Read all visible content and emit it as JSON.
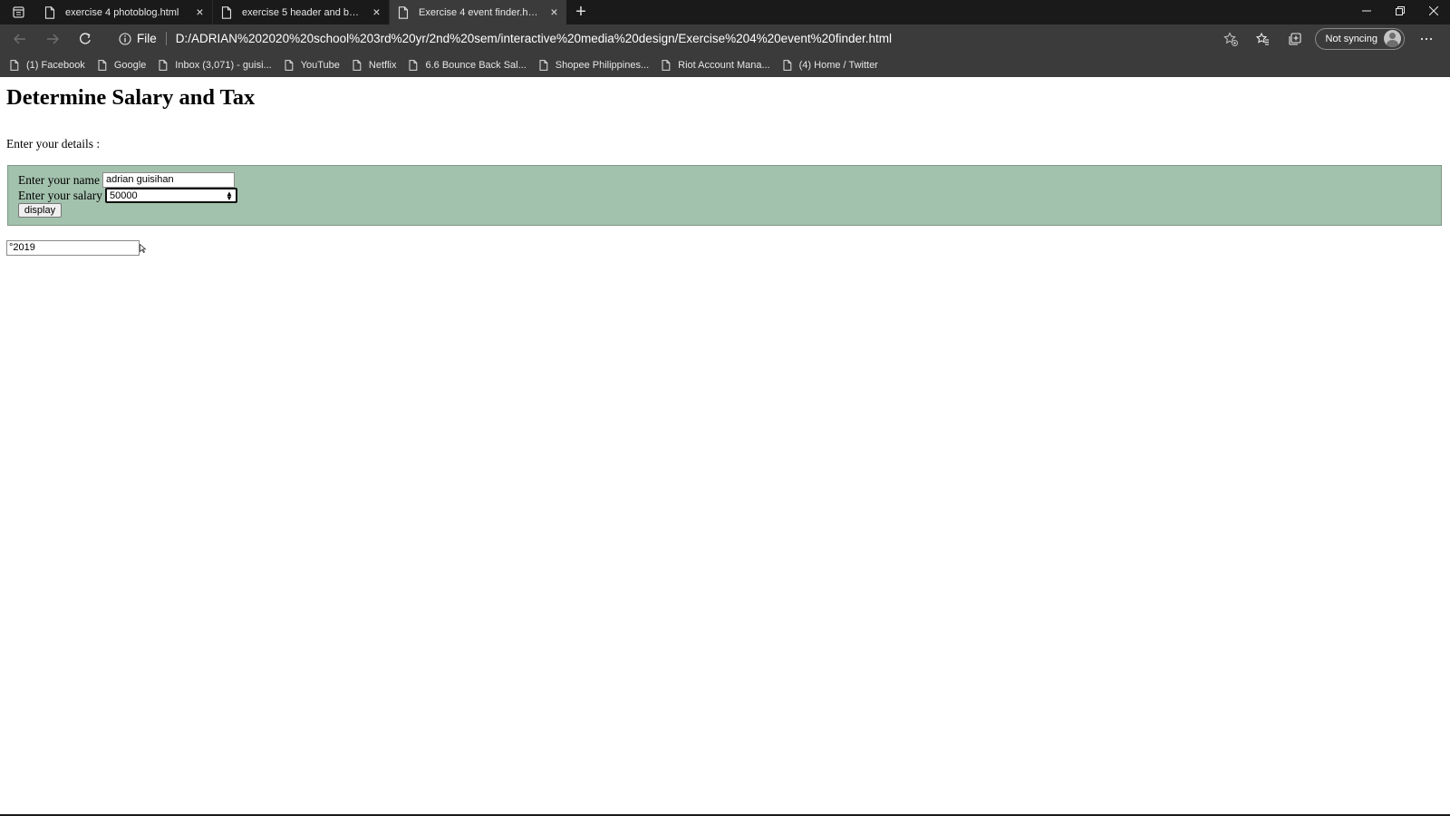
{
  "browser": {
    "tabs": [
      {
        "title": "exercise 4 photoblog.html",
        "active": false
      },
      {
        "title": "exercise 5 header and body.html",
        "active": false
      },
      {
        "title": "Exercise 4 event finder.html",
        "active": true
      }
    ],
    "address": {
      "scheme_label": "File",
      "url": "D:/ADRIAN%202020%20school%203rd%20yr/2nd%20sem/interactive%20media%20design/Exercise%204%20event%20finder.html"
    },
    "sync_label": "Not syncing",
    "bookmarks": [
      "(1) Facebook",
      "Google",
      "Inbox (3,071) - guisi...",
      "YouTube",
      "Netflix",
      "6.6 Bounce Back Sal...",
      "Shopee Philippines...",
      "Riot Account Mana...",
      "(4) Home / Twitter"
    ],
    "icons": {
      "back": "arrow-left-icon",
      "forward": "arrow-right-icon",
      "reload": "reload-icon",
      "info": "info-icon",
      "favorites": "favorites-icon",
      "collections": "collections-icon",
      "menu": "more-icon"
    }
  },
  "page": {
    "title": "Determine Salary and Tax",
    "intro": "Enter your details :",
    "form": {
      "background": "#a3c2ad",
      "name_label": "Enter your name",
      "name_value": "adrian guisihan",
      "salary_label": "Enter your salary",
      "salary_value": "50000",
      "button_label": "display"
    },
    "footer_field_value": "°2019"
  }
}
